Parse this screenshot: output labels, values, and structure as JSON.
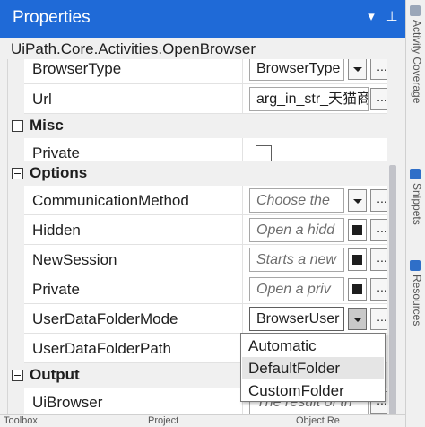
{
  "panel": {
    "title": "Properties"
  },
  "activity": {
    "class_name": "UiPath.Core.Activities.OpenBrowser"
  },
  "rows": {
    "browser_type": {
      "name": "BrowserType",
      "value": "BrowserType"
    },
    "url": {
      "name": "Url",
      "value": "arg_in_str_天猫商"
    },
    "misc": {
      "name": "Misc"
    },
    "misc_private": {
      "name": "Private"
    },
    "options": {
      "name": "Options"
    },
    "communication_method": {
      "name": "CommunicationMethod",
      "placeholder": "Choose the"
    },
    "hidden": {
      "name": "Hidden",
      "placeholder": "Open a hidd"
    },
    "new_session": {
      "name": "NewSession",
      "placeholder": "Starts a new"
    },
    "options_private": {
      "name": "Private",
      "placeholder": "Open a priv"
    },
    "user_data_folder_mode": {
      "name": "UserDataFolderMode",
      "value": "BrowserUser"
    },
    "user_data_folder_path": {
      "name": "UserDataFolderPath"
    },
    "output": {
      "name": "Output"
    },
    "ui_browser": {
      "name": "UiBrowser",
      "placeholder": "The result of th"
    }
  },
  "ellipsis_label": "...",
  "dropdown": {
    "options": [
      "Automatic",
      "DefaultFolder",
      "CustomFolder"
    ],
    "highlighted": "DefaultFolder"
  },
  "side_tabs": [
    "Activity Coverage",
    "Snippets",
    "Resources"
  ],
  "bottom_tabs": [
    "Toolbox",
    "Project",
    "Object Re"
  ],
  "colors": {
    "accent": "#1f6ad7",
    "highlight": "#e5e5e5"
  }
}
